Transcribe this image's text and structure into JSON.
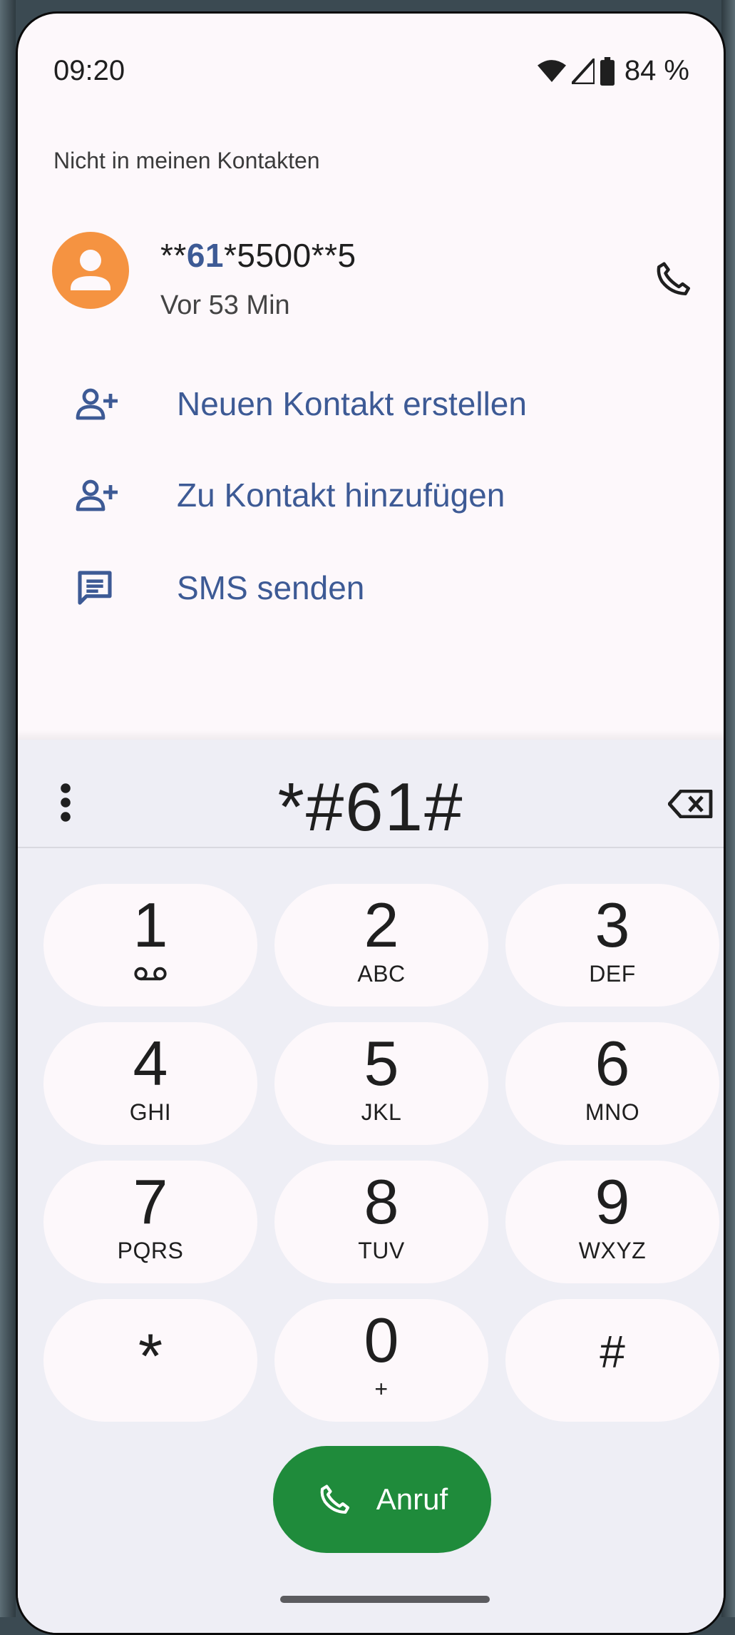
{
  "status_bar": {
    "time": "09:20",
    "battery": "84 %"
  },
  "result": {
    "section_label": "Nicht in meinen Kontakten",
    "number_prefix": "**",
    "number_highlight": "61",
    "number_suffix": "*5500**5",
    "time_ago": "Vor 53 Min",
    "avatar_color": "#f59341"
  },
  "actions": [
    {
      "label": "Neuen Kontakt erstellen",
      "icon": "add-person-icon"
    },
    {
      "label": "Zu Kontakt hinzufügen",
      "icon": "add-person-icon"
    },
    {
      "label": "SMS senden",
      "icon": "message-icon"
    }
  ],
  "dialer": {
    "entered_number": "*#61#",
    "keys": [
      {
        "digit": "1",
        "letters": "",
        "sub_icon": "voicemail-icon"
      },
      {
        "digit": "2",
        "letters": "ABC"
      },
      {
        "digit": "3",
        "letters": "DEF"
      },
      {
        "digit": "4",
        "letters": "GHI"
      },
      {
        "digit": "5",
        "letters": "JKL"
      },
      {
        "digit": "6",
        "letters": "MNO"
      },
      {
        "digit": "7",
        "letters": "PQRS"
      },
      {
        "digit": "8",
        "letters": "TUV"
      },
      {
        "digit": "9",
        "letters": "WXYZ"
      },
      {
        "digit": "*",
        "letters": ""
      },
      {
        "digit": "0",
        "letters": "+"
      },
      {
        "digit": "#",
        "letters": ""
      }
    ],
    "call_label": "Anruf"
  },
  "colors": {
    "accent": "#3d5a95",
    "call_green": "#1f8b3b",
    "dialer_bg": "#eeeef5",
    "key_bg": "#fdf8fb"
  }
}
